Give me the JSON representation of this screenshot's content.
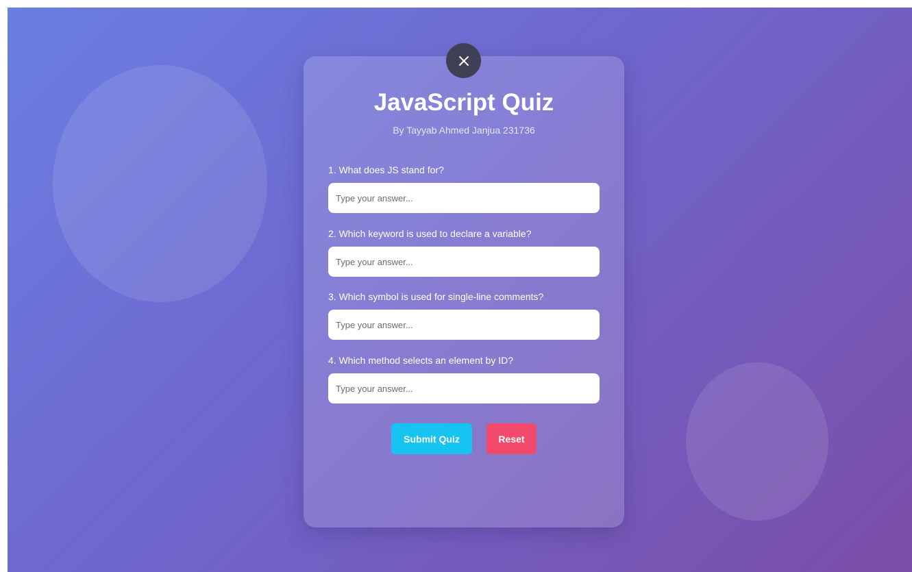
{
  "quiz": {
    "title": "JavaScript Quiz",
    "subtitle": "By Tayyab Ahmed Janjua 231736",
    "close_icon": "close-icon",
    "questions": [
      {
        "label": "1. What does JS stand for?",
        "placeholder": "Type your answer...",
        "value": ""
      },
      {
        "label": "2. Which keyword is used to declare a variable?",
        "placeholder": "Type your answer...",
        "value": ""
      },
      {
        "label": "3. Which symbol is used for single-line comments?",
        "placeholder": "Type your answer...",
        "value": ""
      },
      {
        "label": "4. Which method selects an element by ID?",
        "placeholder": "Type your answer...",
        "value": ""
      }
    ],
    "submit_label": "Submit Quiz",
    "reset_label": "Reset"
  },
  "colors": {
    "background_start": "#6a7fe3",
    "background_end": "#7b4ea8",
    "close_button": "#3f3f55",
    "submit_button": "#17c3f0",
    "reset_button": "#f24a6a"
  }
}
